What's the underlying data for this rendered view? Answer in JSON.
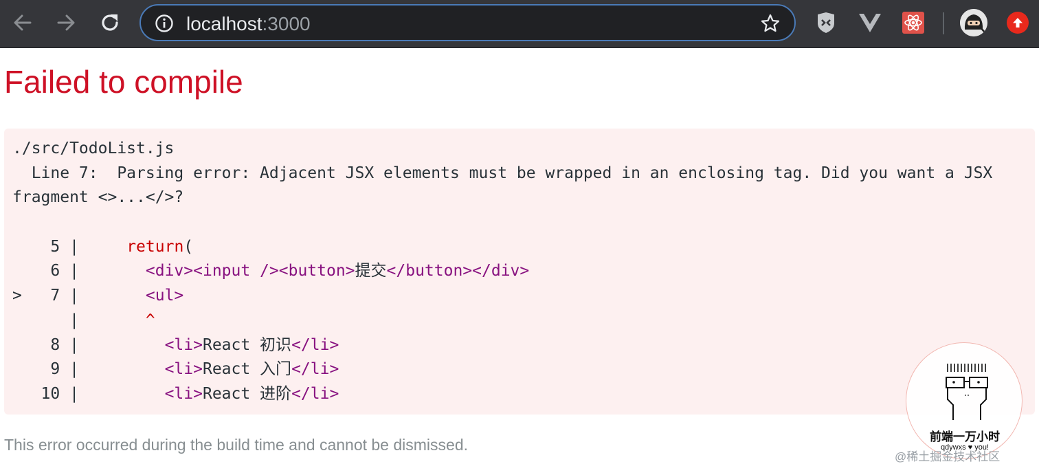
{
  "browser": {
    "url_host": "localhost",
    "url_port": ":3000",
    "icons": {
      "back": "arrow-left-icon",
      "forward": "arrow-right-icon",
      "reload": "reload-icon",
      "info": "info-icon",
      "bookmark": "star-icon",
      "ext_1": "ghostery-icon",
      "ext_2": "vue-devtools-icon",
      "ext_3": "react-devtools-icon",
      "update": "update-arrow-icon"
    }
  },
  "overlay": {
    "title": "Failed to compile",
    "file_path": "./src/TodoList.js",
    "message_line1": "  Line 7:  Parsing error: Adjacent JSX elements must be wrapped in an enclosing tag. Did you want a JSX",
    "message_line2": "fragment <>...</>?",
    "code_frame": [
      {
        "marker": "  ",
        "number": "  5",
        "sep": " |",
        "indent": "     ",
        "keyword": "return",
        "rest": "("
      },
      {
        "marker": "  ",
        "number": "  6",
        "sep": " |",
        "indent": "       ",
        "tag": "<div><input /><button>",
        "text": "提交",
        "tag_end": "</button></div>"
      },
      {
        "marker": "> ",
        "number": "  7",
        "sep": " |",
        "indent": "       ",
        "tag": "<ul>"
      },
      {
        "marker": "  ",
        "number": "   ",
        "sep": " |",
        "indent": "       ",
        "caret": "^"
      },
      {
        "marker": "  ",
        "number": "  8",
        "sep": " |",
        "indent": "         ",
        "tag": "<li>",
        "text": "React 初识",
        "tag_end": "</li>"
      },
      {
        "marker": "  ",
        "number": "  9",
        "sep": " |",
        "indent": "         ",
        "tag": "<li>",
        "text": "React 入门",
        "tag_end": "</li>"
      },
      {
        "marker": "  ",
        "number": " 10",
        "sep": " |",
        "indent": "         ",
        "tag": "<li>",
        "text": "React 进阶",
        "tag_end": "</li>"
      }
    ],
    "footer": "This error occurred during the build time and cannot be dismissed."
  },
  "badge": {
    "title": "前端一万小时",
    "subtitle": "qdywxs ♥ you!"
  },
  "watermark": "@稀土掘金技术社区",
  "colors": {
    "title_red": "#ce1126",
    "keyword_red": "#c80000",
    "tag_purple": "#881280",
    "box_bg": "#fdf0f0",
    "toolbar_bg": "#35363a",
    "omnibox_border": "#4a7ab7"
  }
}
